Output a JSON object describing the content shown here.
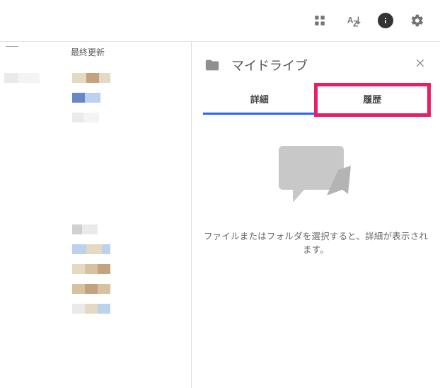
{
  "toolbar": {
    "grid_icon": "grid-view-icon",
    "sort_icon": "sort-az-icon",
    "info_icon": "info-icon",
    "settings_icon": "settings-gear-icon"
  },
  "left": {
    "column_header": "最終更新"
  },
  "panel": {
    "title": "マイドライブ",
    "tabs": {
      "details": "詳細",
      "activity": "履歴"
    },
    "hint": "ファイルまたはフォルダを選択すると、詳細が表示されます。"
  }
}
